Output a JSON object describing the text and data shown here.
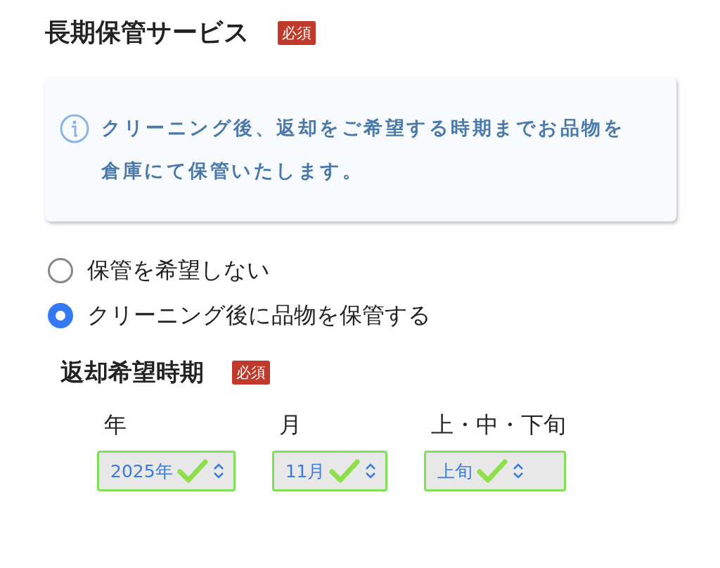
{
  "section": {
    "title": "長期保管サービス",
    "badge": "必須"
  },
  "info": {
    "text": "クリーニング後、返却をご希望する時期までお品物を倉庫にて保管いたします。"
  },
  "options": [
    {
      "label": "保管を希望しない",
      "selected": false
    },
    {
      "label": "クリーニング後に品物を保管する",
      "selected": true
    }
  ],
  "return_period": {
    "title": "返却希望時期",
    "badge": "必須",
    "fields": [
      {
        "label": "年",
        "value": "2025年",
        "valid": true
      },
      {
        "label": "月",
        "value": "11月",
        "valid": true
      },
      {
        "label": "上・中・下旬",
        "value": "上旬",
        "valid": true
      }
    ]
  }
}
